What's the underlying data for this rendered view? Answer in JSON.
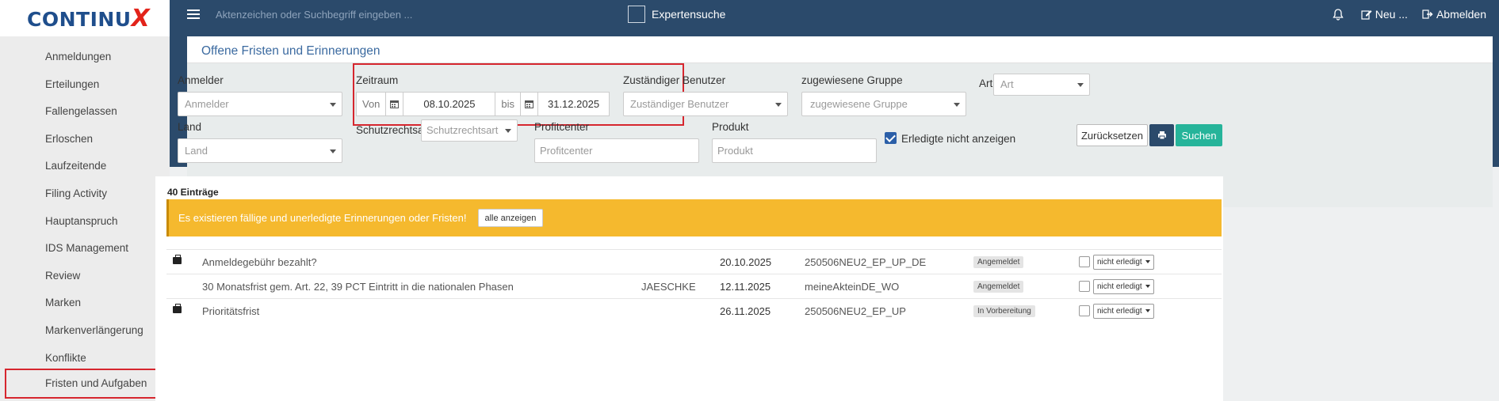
{
  "logo": {
    "text": "CONTINU",
    "accent": "X"
  },
  "sidebar": {
    "items": [
      {
        "label": "Anmeldungen"
      },
      {
        "label": "Erteilungen"
      },
      {
        "label": "Fallengelassen"
      },
      {
        "label": "Erloschen"
      },
      {
        "label": "Laufzeitende"
      },
      {
        "label": "Filing Activity"
      },
      {
        "label": "Hauptanspruch"
      },
      {
        "label": "IDS Management"
      },
      {
        "label": "Review"
      },
      {
        "label": "Marken"
      },
      {
        "label": "Markenverlängerung"
      },
      {
        "label": "Konflikte"
      },
      {
        "label": "Fristen und Aufgaben"
      }
    ]
  },
  "topbar": {
    "search_placeholder": "Aktenzeichen oder Suchbegriff eingeben ...",
    "expert_label": "Expertensuche",
    "new_label": "Neu ...",
    "logout_label": "Abmelden"
  },
  "panel": {
    "title": "Offene Fristen und Erinnerungen"
  },
  "filters": {
    "anmelder": {
      "label": "Anmelder",
      "placeholder": "Anmelder"
    },
    "zeitraum": {
      "label": "Zeitraum",
      "von": "Von",
      "from": "08.10.2025",
      "bis": "bis",
      "to": "31.12.2025"
    },
    "benutzer": {
      "label": "Zuständiger Benutzer",
      "placeholder": "Zuständiger Benutzer"
    },
    "gruppe": {
      "label": "zugewiesene Gruppe",
      "placeholder": "zugewiesene Gruppe"
    },
    "art": {
      "label": "Art",
      "placeholder": "Art"
    },
    "land": {
      "label": "Land",
      "placeholder": "Land"
    },
    "schutzrechtsart": {
      "label": "Schutzrechtsart",
      "placeholder": "Schutzrechtsart"
    },
    "profitcenter": {
      "label": "Profitcenter",
      "placeholder": "Profitcenter"
    },
    "produkt": {
      "label": "Produkt",
      "placeholder": "Produkt"
    },
    "erledigt_label": "Erledigte nicht anzeigen",
    "reset_label": "Zurücksetzen",
    "search_label": "Suchen"
  },
  "results": {
    "count": "40 Einträge",
    "alert_text": "Es existieren fällige und unerledigte Erinnerungen oder Fristen!",
    "alert_button": "alle anzeigen",
    "rows": [
      {
        "title": "Anmeldegebühr bezahlt?",
        "user": "",
        "date": "20.10.2025",
        "akte": "250506NEU2_EP_UP_DE",
        "status": "Angemeldet",
        "state": "nicht erledigt"
      },
      {
        "title": "30 Monatsfrist gem. Art. 22, 39 PCT Eintritt in die nationalen Phasen",
        "user": "JAESCHKE",
        "date": "12.11.2025",
        "akte": "meineAkteinDE_WO",
        "status": "Angemeldet",
        "state": "nicht erledigt"
      },
      {
        "title": "Prioritätsfrist",
        "user": "",
        "date": "26.11.2025",
        "akte": "250506NEU2_EP_UP",
        "status": "In Vorbereitung",
        "state": "nicht erledigt"
      }
    ]
  },
  "colors": {
    "topbar": "#2b4a6b",
    "accent_red": "#d6262e",
    "alert": "#f5b92e",
    "search_button": "#26b49a"
  }
}
